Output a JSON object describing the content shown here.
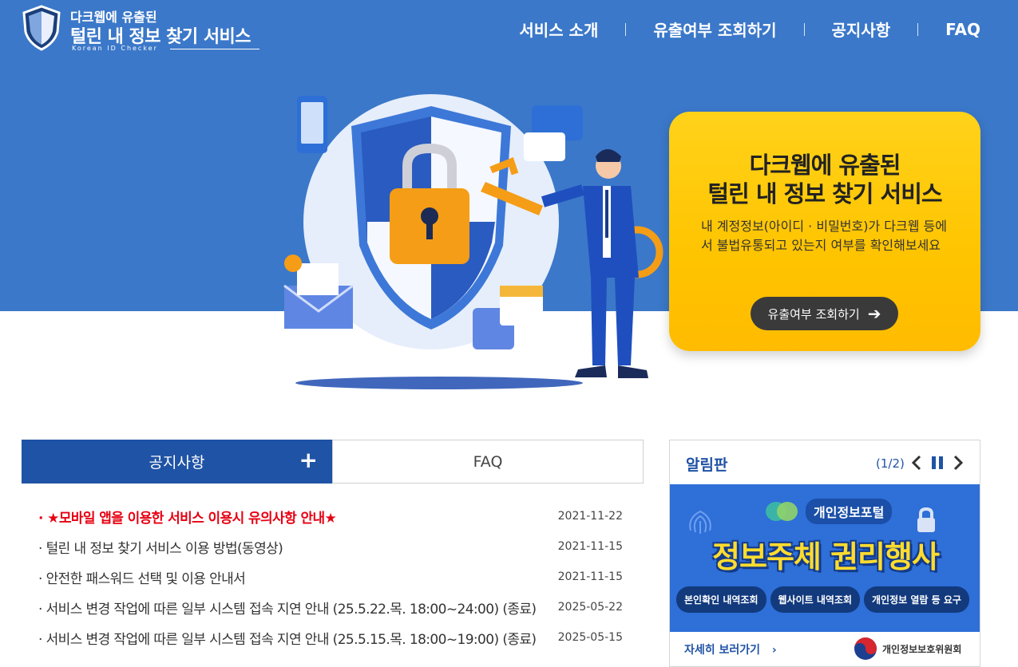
{
  "header": {
    "logo_line1": "다크웹에 유출된",
    "logo_line2": "털린 내 정보 찾기 서비스",
    "logo_sub": "Korean ID Checker",
    "nav": [
      "서비스 소개",
      "유출여부 조회하기",
      "공지사항",
      "FAQ"
    ]
  },
  "promo": {
    "title_line1": "다크웹에 유출된",
    "title_line2": "털린 내 정보 찾기 서비스",
    "description": "내 계정정보(아이디 · 비밀번호)가 다크웹 등에서 불법유통되고 있는지 여부를 확인해보세요",
    "button_label": "유출여부 조회하기"
  },
  "tabs": {
    "active_label": "공지사항",
    "inactive_label": "FAQ",
    "plus": "+"
  },
  "notices": [
    {
      "title": "· ★모바일 앱을 이용한 서비스 이용시 유의사항 안내★",
      "date": "2021-11-22"
    },
    {
      "title": "· 털린 내 정보 찾기 서비스 이용 방법(동영상)",
      "date": "2021-11-15"
    },
    {
      "title": "· 안전한 패스워드 선택 및 이용 안내서",
      "date": "2021-11-15"
    },
    {
      "title": "· 서비스 변경 작업에 따른 일부 시스템 접속 지연 안내 (25.5.22.목. 18:00~24:00) (종료)",
      "date": "2025-05-22"
    },
    {
      "title": "· 서비스 변경 작업에 따른 일부 시스템 접속 지연 안내 (25.5.15.목. 18:00~19:00) (종료)",
      "date": "2025-05-15"
    }
  ],
  "board": {
    "title": "알림판",
    "page": "(1/2)",
    "banner_portal": "개인정보포털",
    "banner_title": "정보주체 권리행사",
    "banner_pills": [
      "본인확인 내역조회",
      "웹사이트 내역조회",
      "개인정보 열람 등 요구"
    ],
    "more_label": "자세히 보러가기",
    "agency": "개인정보보호위원회"
  },
  "colors": {
    "hero_blue": "#3b78c9",
    "tab_blue": "#1f53a5",
    "promo_yellow": "#ffc400",
    "highlight_red": "#e60012"
  }
}
